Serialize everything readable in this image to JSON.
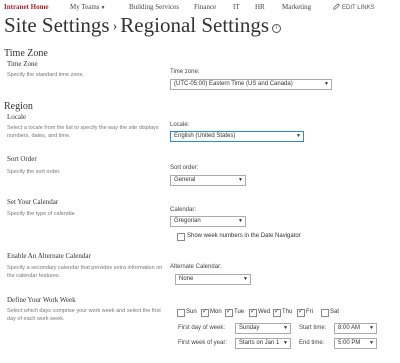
{
  "nav": {
    "home": "Intranet Home",
    "items": [
      "My Teams",
      "Building Services",
      "Finance",
      "IT",
      "HR",
      "Marketing"
    ],
    "edit_links": "EDIT LINKS"
  },
  "page": {
    "breadcrumb_root": "Site Settings",
    "breadcrumb_sep": "›",
    "title": "Regional Settings",
    "info": "i"
  },
  "time_zone": {
    "section": "Time Zone",
    "heading": "Time Zone",
    "desc": "Specify the standard time zone.",
    "label": "Time zone:",
    "value": "(UTC-05:00) Eastern Time (US and Canada)"
  },
  "region": {
    "section": "Region",
    "locale": {
      "heading": "Locale",
      "desc": "Select a locale from the list to specify the way the site displays numbers, dates, and time.",
      "label": "Locale:",
      "value": "English (United States)"
    },
    "sort_order": {
      "heading": "Sort Order",
      "desc": "Specify the sort order.",
      "label": "Sort order:",
      "value": "General"
    },
    "calendar": {
      "heading": "Set Your Calendar",
      "desc": "Specify the type of calendar.",
      "label": "Calendar:",
      "value": "Gregorian",
      "week_numbers_label": "Show week numbers in the Date Navigator",
      "week_numbers_checked": false
    },
    "alt_calendar": {
      "heading": "Enable An Alternate Calendar",
      "desc": "Specify a secondary calendar that provides extra information on the calendar features.",
      "label": "Alternate Calendar:",
      "value": "None"
    },
    "work_week": {
      "heading": "Define Your Work Week",
      "desc": "Select which days comprise your work week and select the first day of each work week.",
      "days": [
        {
          "label": "Sun",
          "checked": false
        },
        {
          "label": "Mon",
          "checked": true
        },
        {
          "label": "Tue",
          "checked": true
        },
        {
          "label": "Wed",
          "checked": true
        },
        {
          "label": "Thu",
          "checked": true
        },
        {
          "label": "Fri",
          "checked": true
        },
        {
          "label": "Sat",
          "checked": false
        }
      ],
      "first_day_label": "First day of week:",
      "first_day_value": "Sunday",
      "first_week_label": "First week of year:",
      "first_week_value": "Starts on Jan 1",
      "start_time_label": "Start time:",
      "start_time_value": "8:00 AM",
      "end_time_label": "End time:",
      "end_time_value": "5:00 PM"
    }
  }
}
